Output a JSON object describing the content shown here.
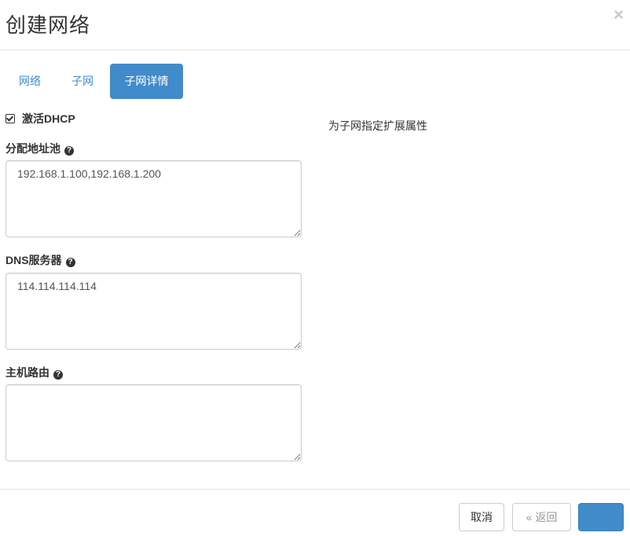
{
  "dialog": {
    "title": "创建网络",
    "close_glyph": "×"
  },
  "tabs": [
    {
      "label": "网络",
      "active": false
    },
    {
      "label": "子网",
      "active": false
    },
    {
      "label": "子网详情",
      "active": true
    }
  ],
  "form": {
    "enable_dhcp": {
      "label": "激活DHCP",
      "checked": true
    },
    "allocation_pools": {
      "label": "分配地址池",
      "value": "192.168.1.100,192.168.1.200"
    },
    "dns_servers": {
      "label": "DNS服务器",
      "value": "114.114.114.114"
    },
    "host_routes": {
      "label": "主机路由",
      "value": ""
    },
    "help_glyph": "?"
  },
  "side_description": "为子网指定扩展属性",
  "footer": {
    "cancel_label": "取消",
    "back_label": "« 返回",
    "primary_label": ""
  },
  "colors": {
    "accent": "#428bca",
    "border": "#cccccc",
    "divider": "#e5e5e5"
  }
}
